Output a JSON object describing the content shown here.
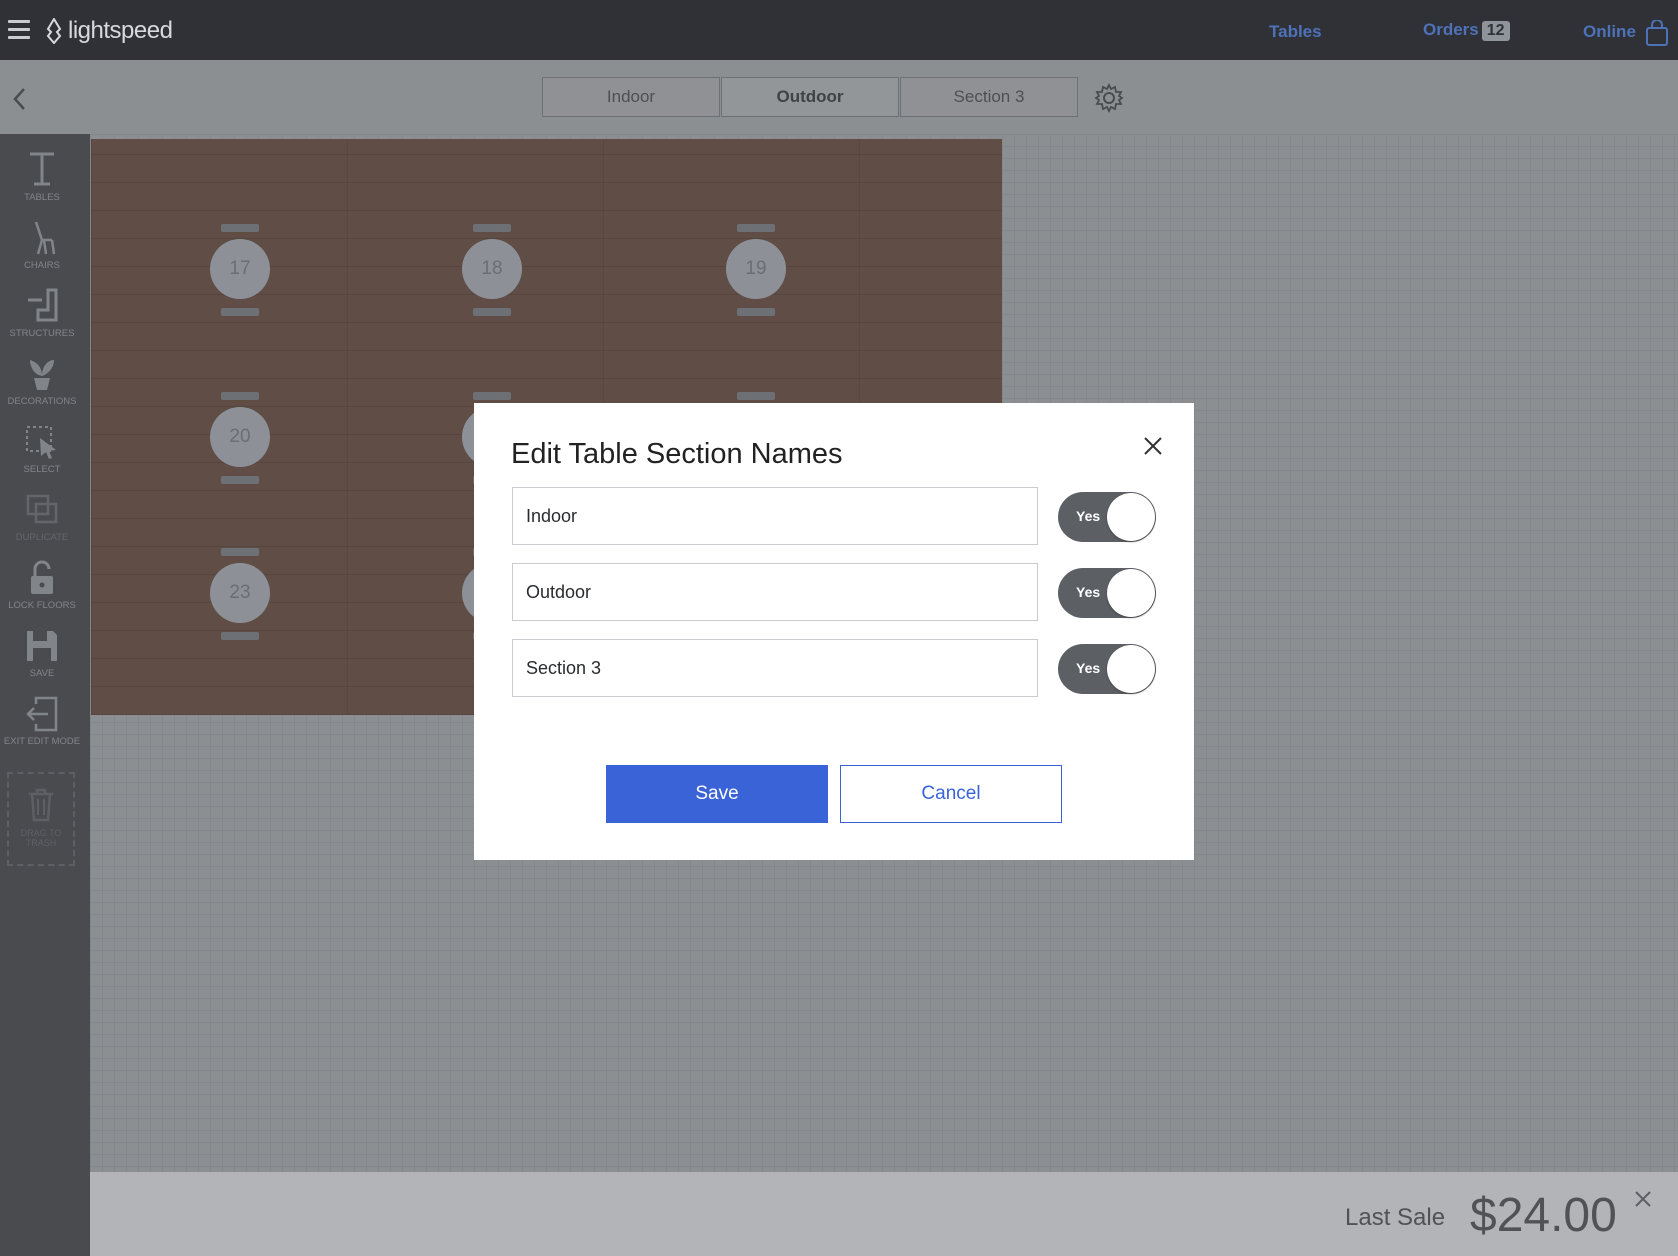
{
  "header": {
    "brand": "lightspeed",
    "nav": {
      "tables": "Tables",
      "orders": "Orders",
      "orders_count": "12",
      "online": "Online"
    }
  },
  "section_tabs": [
    "Indoor",
    "Outdoor",
    "Section 3"
  ],
  "active_tab": "Outdoor",
  "tools": [
    {
      "label": "TABLES",
      "icon": "table-icon"
    },
    {
      "label": "CHAIRS",
      "icon": "chair-icon"
    },
    {
      "label": "STRUCTURES",
      "icon": "structure-icon"
    },
    {
      "label": "DECORATIONS",
      "icon": "plant-icon"
    },
    {
      "label": "SELECT",
      "icon": "select-cursor-icon"
    },
    {
      "label": "DUPLICATE",
      "icon": "duplicate-icon"
    },
    {
      "label": "LOCK FLOORS",
      "icon": "lock-icon"
    },
    {
      "label": "SAVE",
      "icon": "save-icon"
    },
    {
      "label": "EXIT EDIT MODE",
      "icon": "exit-icon"
    }
  ],
  "trash": {
    "label": "DRAG TO TRASH"
  },
  "floor_tables": [
    "17",
    "18",
    "19",
    "20",
    "23"
  ],
  "modal": {
    "title": "Edit Table Section Names",
    "sections": [
      {
        "name": "Indoor",
        "toggle": "Yes"
      },
      {
        "name": "Outdoor",
        "toggle": "Yes"
      },
      {
        "name": "Section 3",
        "toggle": "Yes"
      }
    ],
    "save_label": "Save",
    "cancel_label": "Cancel"
  },
  "footer": {
    "last_sale_label": "Last Sale",
    "last_sale_amount": "$24.00"
  },
  "colors": {
    "accent": "#3a63d8",
    "nav_link": "#4e72b8",
    "topbar": "#2f3136",
    "floor_wood": "#5b3f33"
  }
}
